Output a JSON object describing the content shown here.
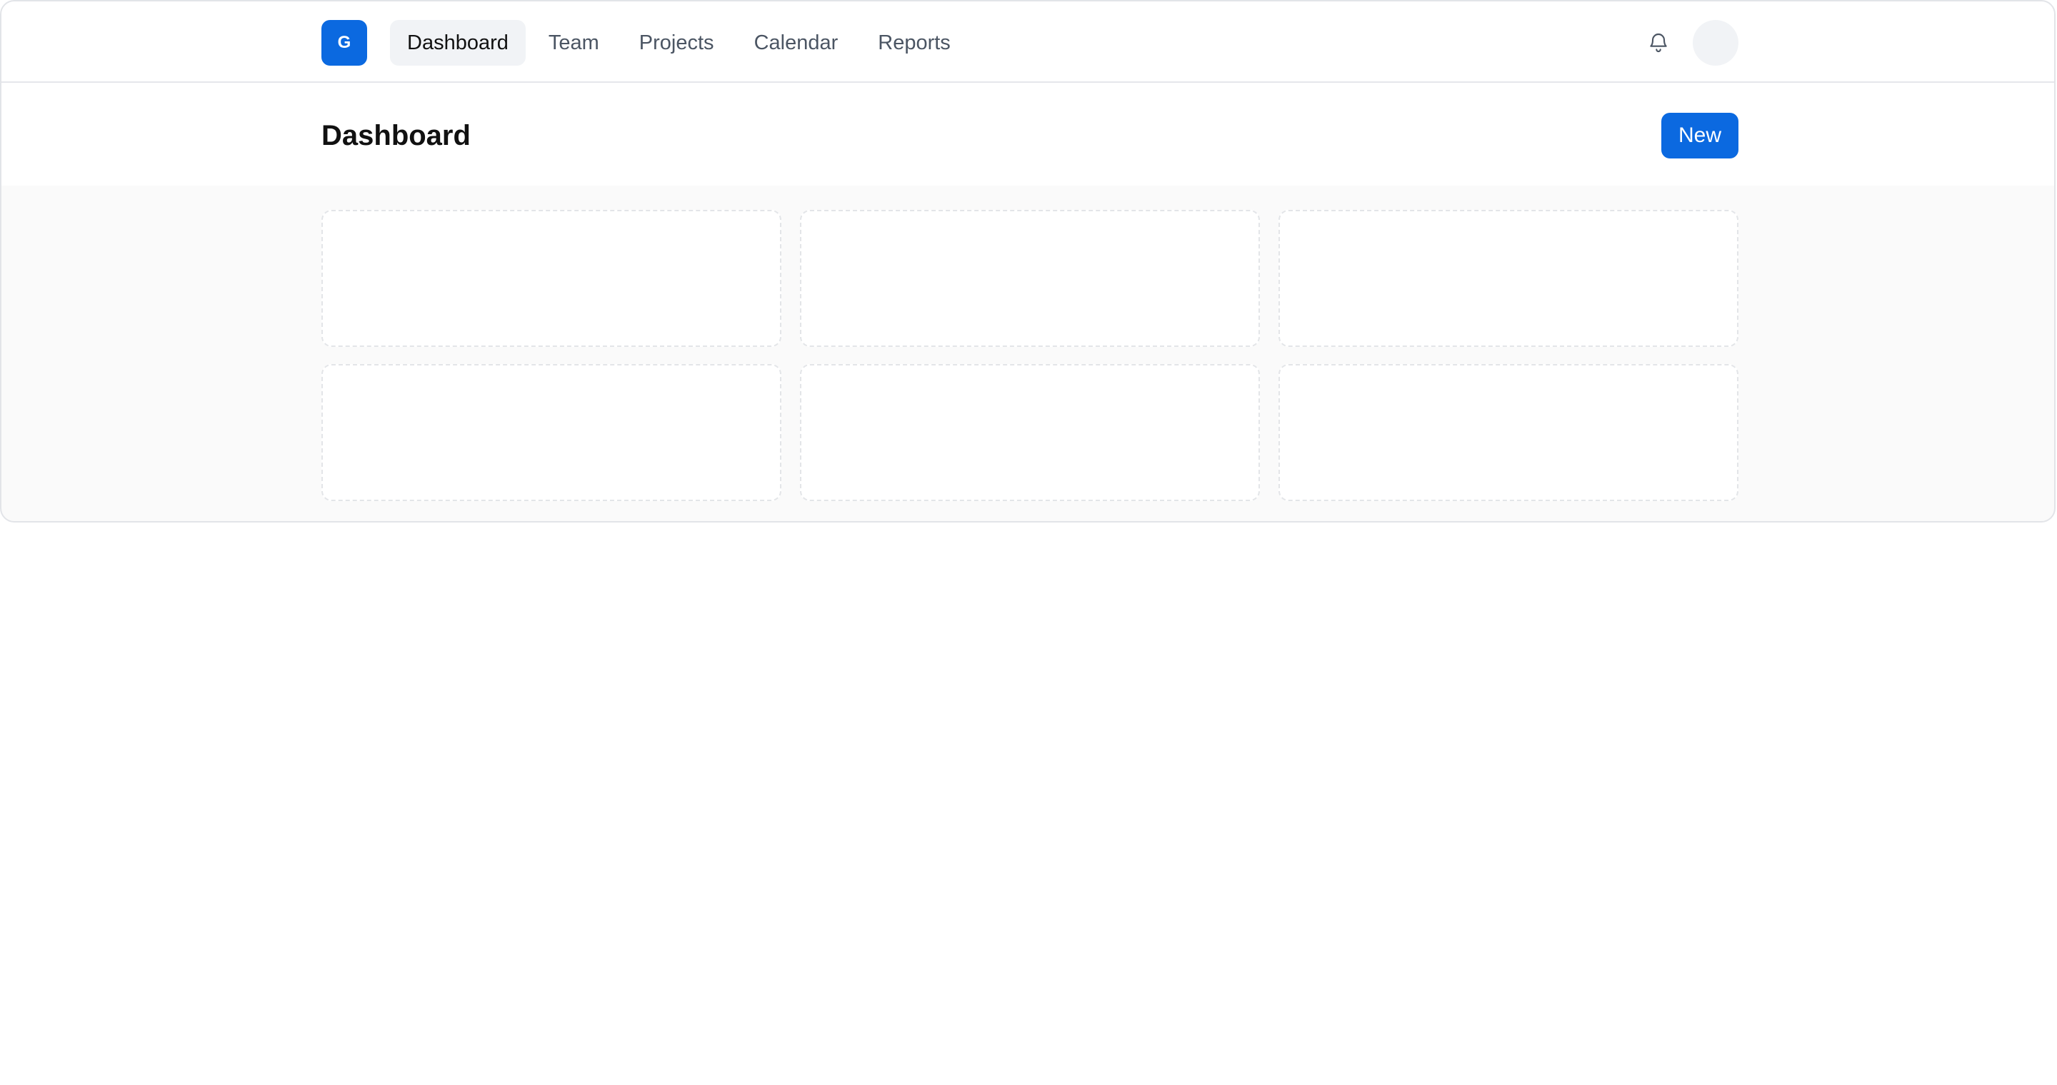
{
  "navbar": {
    "logo_letter": "G",
    "items": [
      {
        "label": "Dashboard",
        "active": true
      },
      {
        "label": "Team",
        "active": false
      },
      {
        "label": "Projects",
        "active": false
      },
      {
        "label": "Calendar",
        "active": false
      },
      {
        "label": "Reports",
        "active": false
      }
    ],
    "icons": {
      "notifications": "bell-icon"
    }
  },
  "header": {
    "title": "Dashboard",
    "new_button_label": "New"
  },
  "colors": {
    "accent": "#0b69e0",
    "nav_active_bg": "#f1f3f6",
    "content_bg": "#fafafa",
    "card_border": "#e3e5e8"
  },
  "cards_count": 6
}
